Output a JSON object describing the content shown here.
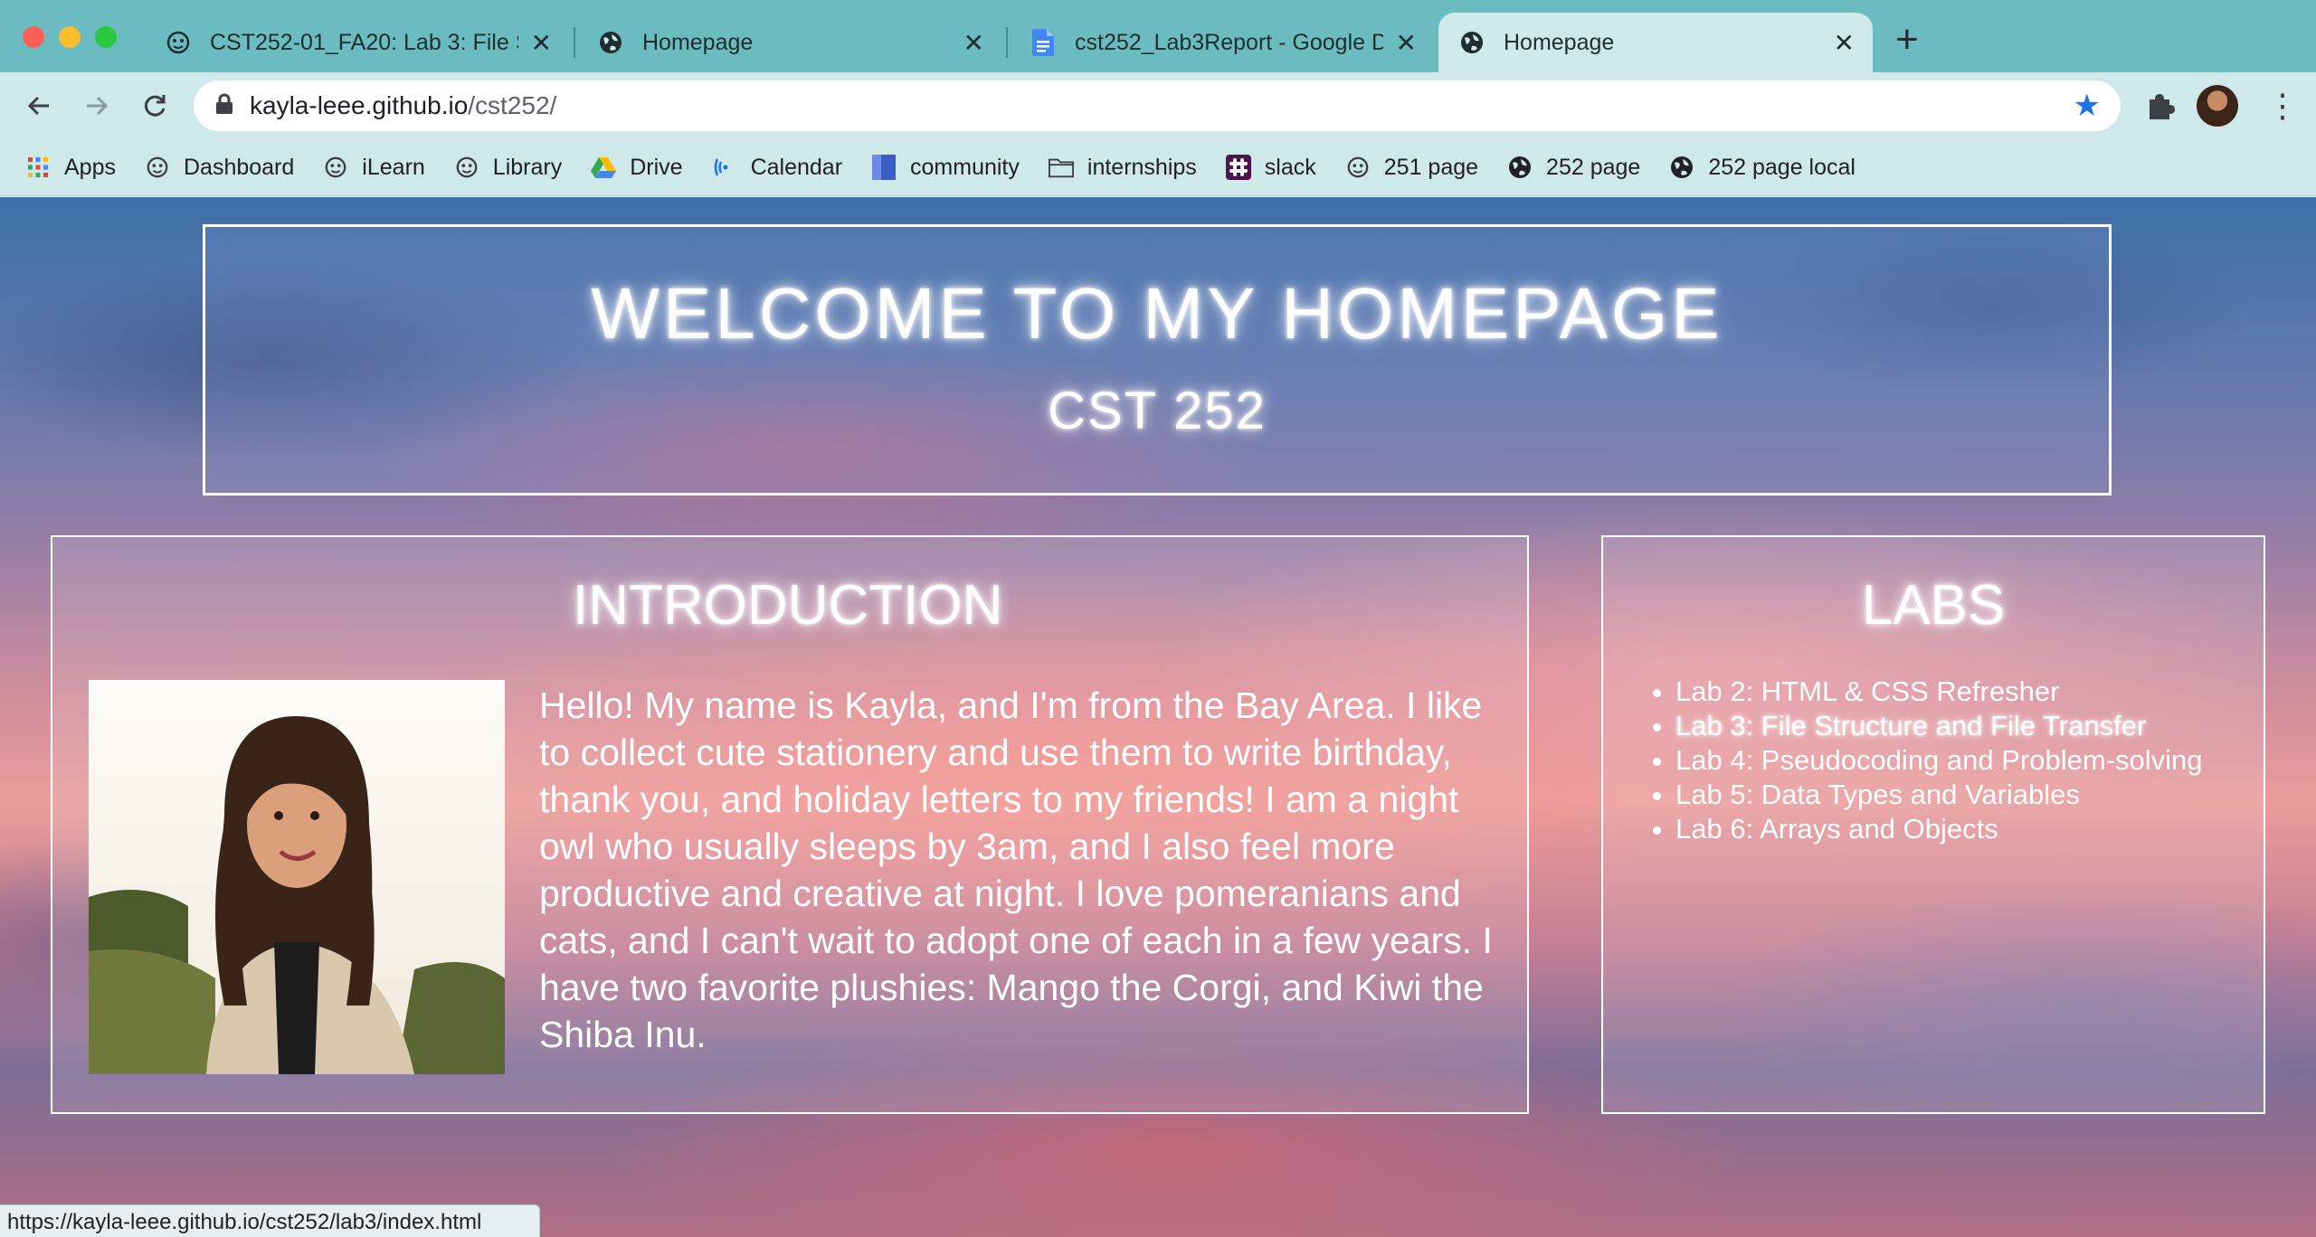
{
  "browser": {
    "tabs": [
      {
        "title": "CST252-01_FA20: Lab 3: File S",
        "icon": "csumb-otter-icon",
        "active": false
      },
      {
        "title": "Homepage",
        "icon": "globe-icon",
        "active": false
      },
      {
        "title": "cst252_Lab3Report - Google D",
        "icon": "google-docs-icon",
        "active": false
      },
      {
        "title": "Homepage",
        "icon": "globe-icon",
        "active": true
      }
    ],
    "close_glyph": "✕",
    "new_tab_glyph": "+",
    "address": {
      "host": "kayla-leee.github.io",
      "path": "/cst252/"
    },
    "bookmarks": [
      {
        "label": "Apps",
        "icon": "apps-grid-icon"
      },
      {
        "label": "Dashboard",
        "icon": "csumb-otter-icon"
      },
      {
        "label": "iLearn",
        "icon": "csumb-otter-icon"
      },
      {
        "label": "Library",
        "icon": "csumb-otter-icon"
      },
      {
        "label": "Drive",
        "icon": "google-drive-icon"
      },
      {
        "label": "Calendar",
        "icon": "calendar-icon"
      },
      {
        "label": "community",
        "icon": "community-icon"
      },
      {
        "label": "internships",
        "icon": "folder-icon"
      },
      {
        "label": "slack",
        "icon": "slack-icon"
      },
      {
        "label": "251 page",
        "icon": "csumb-otter-icon"
      },
      {
        "label": "252 page",
        "icon": "globe-icon"
      },
      {
        "label": "252 page local",
        "icon": "globe-icon"
      }
    ],
    "status_url": "https://kayla-leee.github.io/cst252/lab3/index.html",
    "colors": {
      "tab_strip": "#6bbcc1",
      "toolbar": "#cfe9eb",
      "star": "#1a73e8"
    }
  },
  "page": {
    "header": {
      "title": "WELCOME TO MY HOMEPAGE",
      "subtitle": "CST 252"
    },
    "intro": {
      "heading": "INTRODUCTION",
      "text": "Hello! My name is Kayla, and I'm from the Bay Area. I like to collect cute stationery and use them to write birthday, thank you, and holiday letters to my friends! I am a night owl who usually sleeps by 3am, and I also feel more productive and creative at night. I love pomeranians and cats, and I can't wait to adopt one of each in a few years. I have two favorite plushies: Mango the Corgi, and Kiwi the Shiba Inu."
    },
    "labs": {
      "heading": "LABS",
      "items": [
        {
          "label": "Lab 2: HTML & CSS Refresher",
          "hovered": false
        },
        {
          "label": "Lab 3: File Structure and File Transfer",
          "hovered": true
        },
        {
          "label": "Lab 4: Pseudocoding and Problem-solving",
          "hovered": false
        },
        {
          "label": "Lab 5: Data Types and Variables",
          "hovered": false
        },
        {
          "label": "Lab 6: Arrays and Objects",
          "hovered": false
        }
      ]
    }
  }
}
